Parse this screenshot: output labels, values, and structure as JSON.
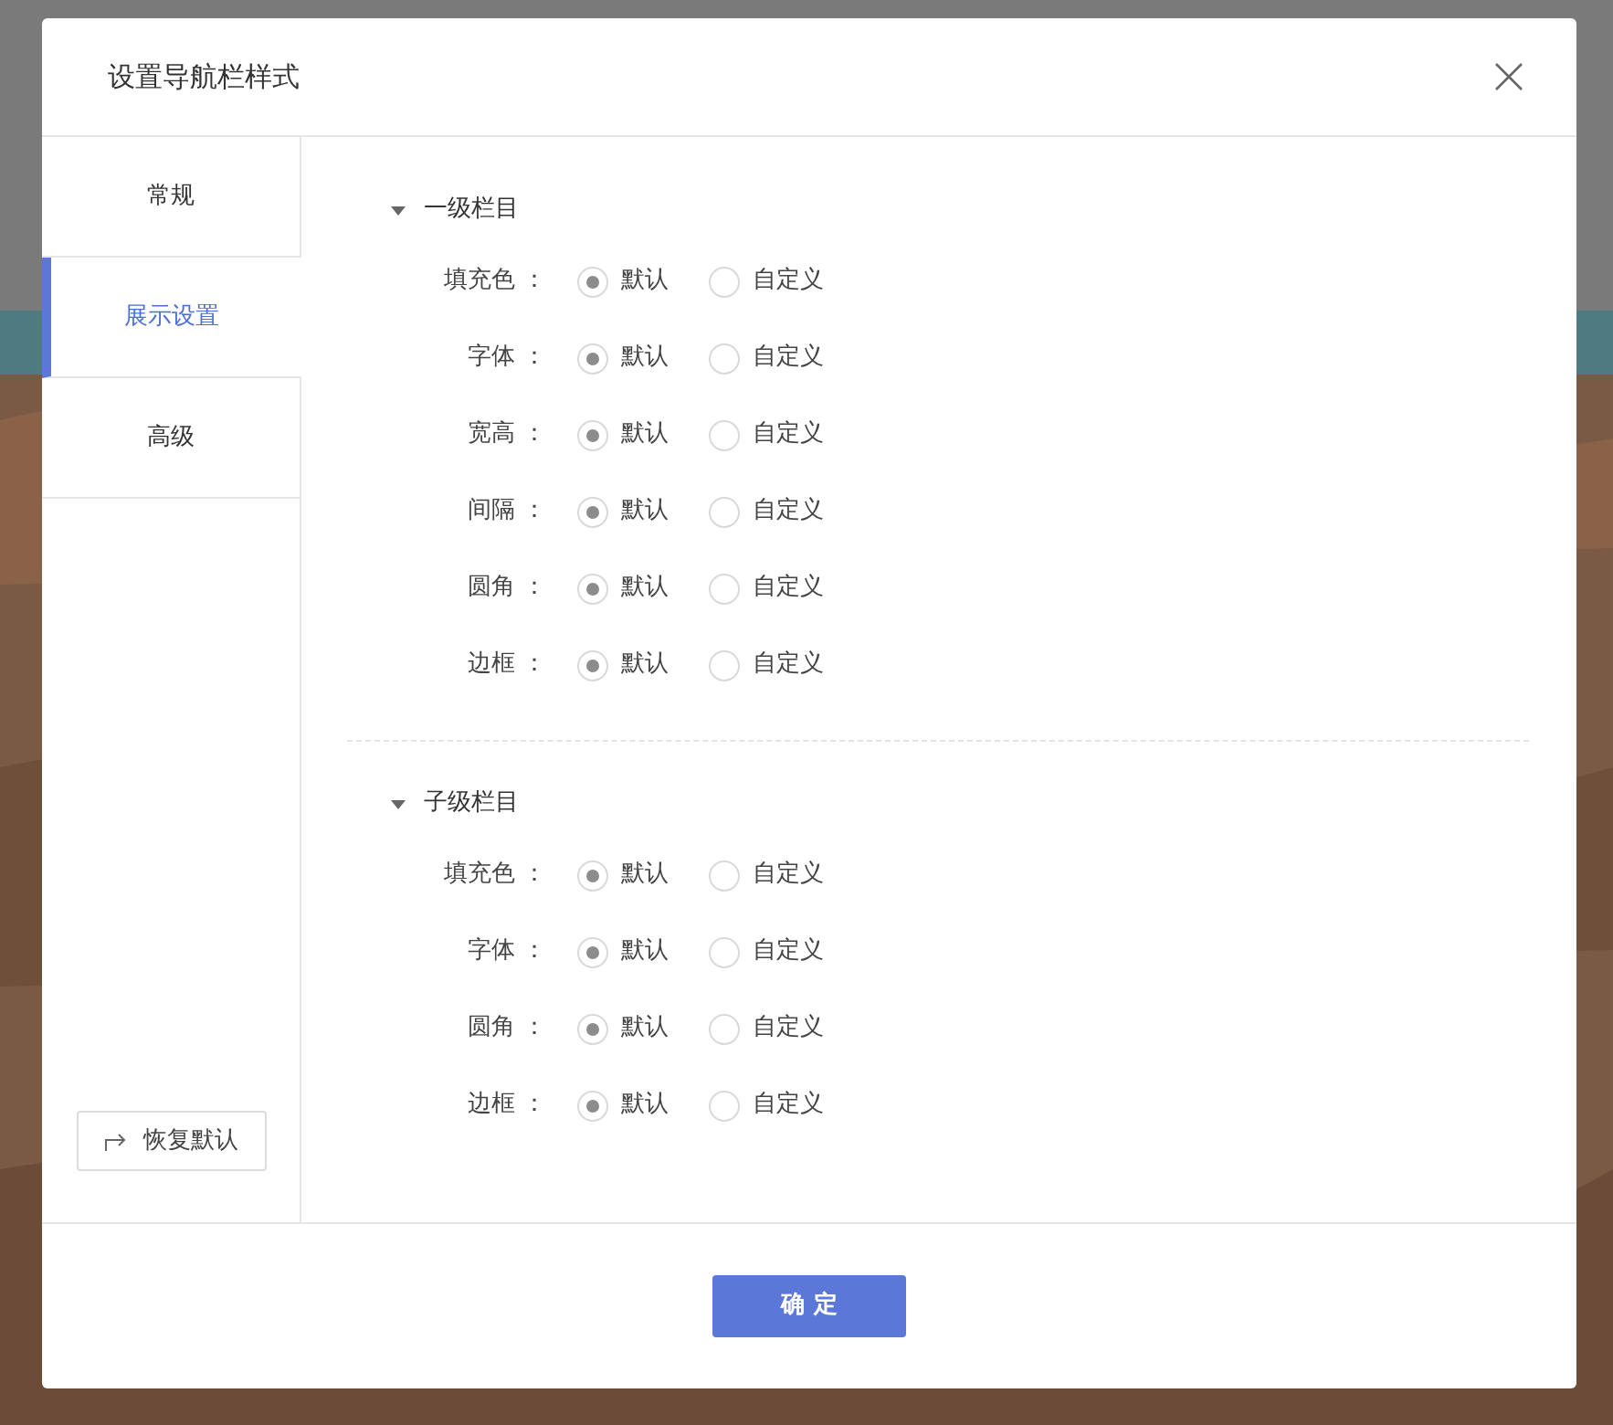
{
  "dialog": {
    "title": "设置导航栏样式"
  },
  "tabs": [
    {
      "label": "常规",
      "selected": false
    },
    {
      "label": "展示设置",
      "selected": true
    },
    {
      "label": "高级",
      "selected": false
    }
  ],
  "reset_button": {
    "label": "恢复默认"
  },
  "sections": [
    {
      "title": "一级栏目",
      "expanded": true,
      "rows": [
        {
          "label": "填充色 ：",
          "options": [
            {
              "label": "默认",
              "selected": true
            },
            {
              "label": "自定义",
              "selected": false
            }
          ]
        },
        {
          "label": "字体 ：",
          "options": [
            {
              "label": "默认",
              "selected": true
            },
            {
              "label": "自定义",
              "selected": false
            }
          ]
        },
        {
          "label": "宽高 ：",
          "options": [
            {
              "label": "默认",
              "selected": true
            },
            {
              "label": "自定义",
              "selected": false
            }
          ]
        },
        {
          "label": "间隔 ：",
          "options": [
            {
              "label": "默认",
              "selected": true
            },
            {
              "label": "自定义",
              "selected": false
            }
          ]
        },
        {
          "label": "圆角 ：",
          "options": [
            {
              "label": "默认",
              "selected": true
            },
            {
              "label": "自定义",
              "selected": false
            }
          ]
        },
        {
          "label": "边框 ：",
          "options": [
            {
              "label": "默认",
              "selected": true
            },
            {
              "label": "自定义",
              "selected": false
            }
          ]
        }
      ]
    },
    {
      "title": "子级栏目",
      "expanded": true,
      "rows": [
        {
          "label": "填充色 ：",
          "options": [
            {
              "label": "默认",
              "selected": true
            },
            {
              "label": "自定义",
              "selected": false
            }
          ]
        },
        {
          "label": "字体 ：",
          "options": [
            {
              "label": "默认",
              "selected": true
            },
            {
              "label": "自定义",
              "selected": false
            }
          ]
        },
        {
          "label": "圆角 ：",
          "options": [
            {
              "label": "默认",
              "selected": true
            },
            {
              "label": "自定义",
              "selected": false
            }
          ]
        },
        {
          "label": "边框 ：",
          "options": [
            {
              "label": "默认",
              "selected": true
            },
            {
              "label": "自定义",
              "selected": false
            }
          ]
        }
      ]
    }
  ],
  "confirm_button": {
    "label": "确 定"
  }
}
